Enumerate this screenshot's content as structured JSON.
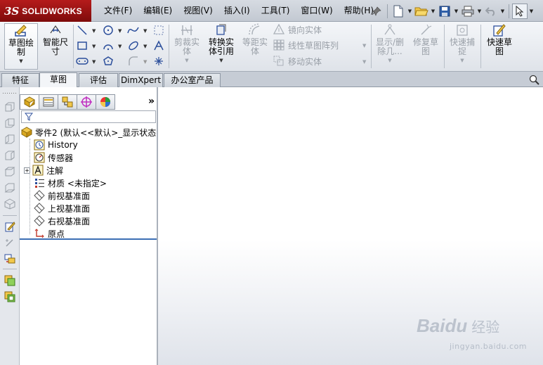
{
  "app": {
    "brand_prefix": "3S",
    "brand_name": "SOLIDWORKS"
  },
  "menu": [
    {
      "label": "文件(F)"
    },
    {
      "label": "编辑(E)"
    },
    {
      "label": "视图(V)"
    },
    {
      "label": "插入(I)"
    },
    {
      "label": "工具(T)"
    },
    {
      "label": "窗口(W)"
    },
    {
      "label": "帮助(H)"
    }
  ],
  "command_manager": {
    "sketch": "草图绘制",
    "smart_dimension": "智能尺寸",
    "trim": "剪裁实体",
    "convert": "转换实体引用",
    "offset": "等距实体",
    "mirror": "镜向实体",
    "linear_pattern": "线性草图阵列",
    "move": "移动实体",
    "display_delete": "显示/删除几...",
    "repair": "修复草图",
    "quick_snap": "快速捕捉",
    "rapid_sketch": "快速草图"
  },
  "tabs": [
    {
      "label": "特征"
    },
    {
      "label": "草图"
    },
    {
      "label": "评估"
    },
    {
      "label": "DimXpert"
    },
    {
      "label": "办公室产品"
    }
  ],
  "active_tab": "草图",
  "feature_tree": {
    "root": "零件2 (默认<<默认>_显示状态",
    "items": [
      {
        "label": "History",
        "icon": "history-icon"
      },
      {
        "label": "传感器",
        "icon": "sensor-icon"
      },
      {
        "label": "注解",
        "icon": "annotation-icon"
      },
      {
        "label": "材质 <未指定>",
        "icon": "material-icon"
      },
      {
        "label": "前视基准面",
        "icon": "plane-icon"
      },
      {
        "label": "上视基准面",
        "icon": "plane-icon"
      },
      {
        "label": "右视基准面",
        "icon": "plane-icon"
      },
      {
        "label": "原点",
        "icon": "origin-icon"
      }
    ]
  },
  "watermark": {
    "brand": "Baidu",
    "product": "经验",
    "url": "jingyan.baidu.com"
  },
  "colors": {
    "accent": "#3c6fb4",
    "brand_red": "#b51b1b"
  }
}
